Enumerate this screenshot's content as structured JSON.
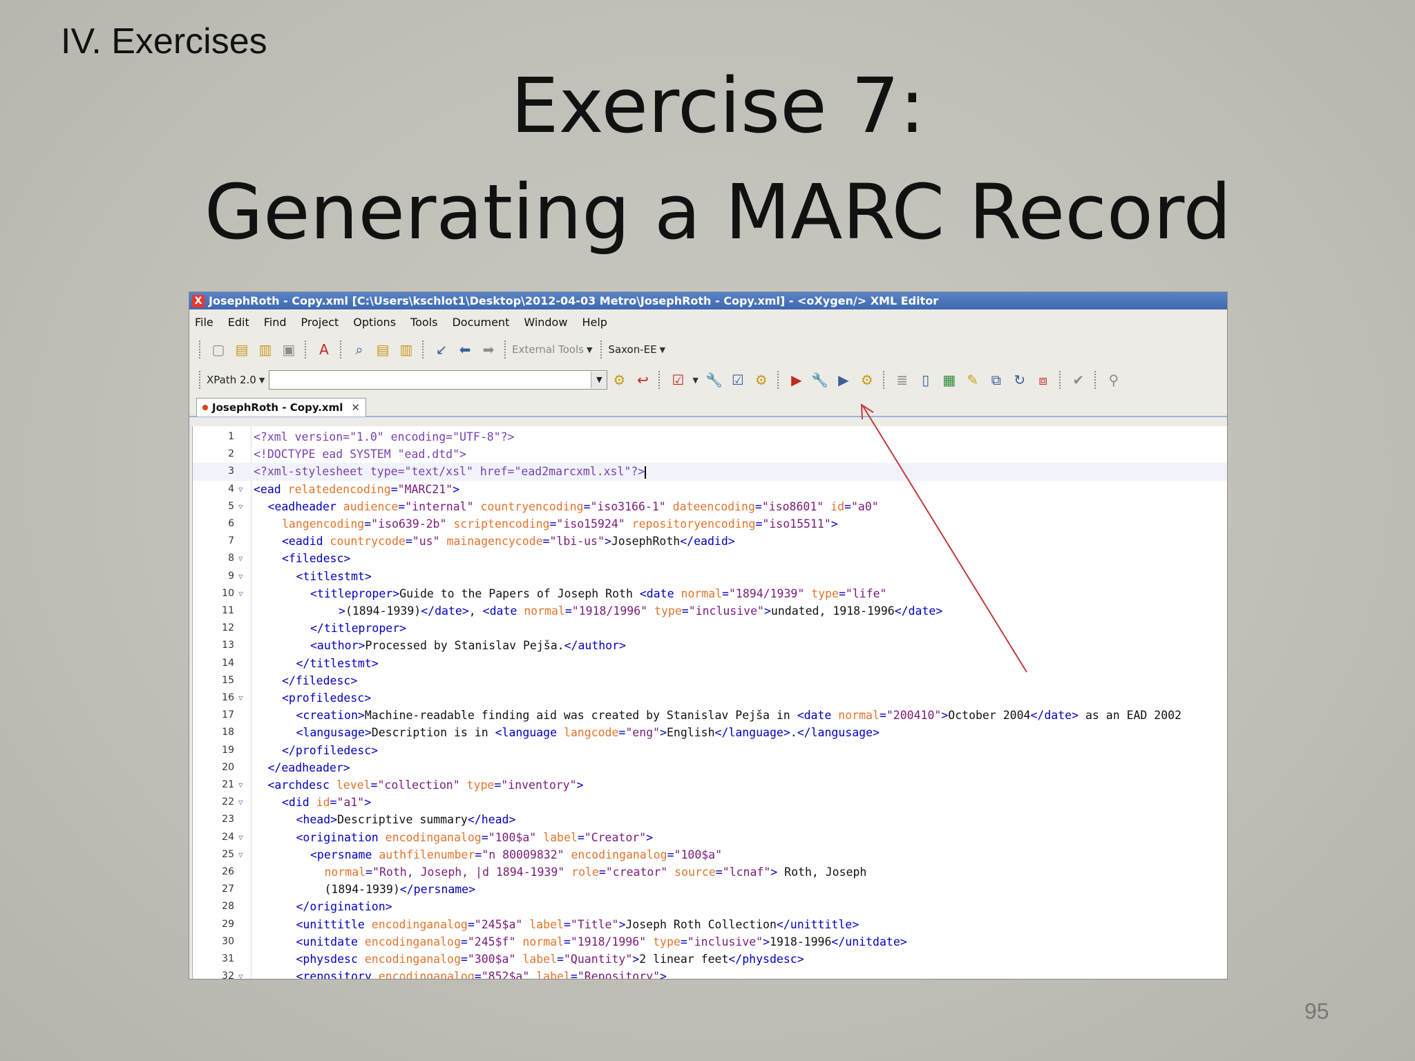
{
  "slide": {
    "section": "IV. Exercises",
    "title_line1": "Exercise 7:",
    "title_line2": "Generating a MARC Record",
    "page_number": "95"
  },
  "window": {
    "title": "JosephRoth - Copy.xml [C:\\Users\\kschlot1\\Desktop\\2012-04-03 Metro\\JosephRoth - Copy.xml] - <oXygen/> XML Editor",
    "app_icon": "oxygen-x-icon"
  },
  "menu": [
    "File",
    "Edit",
    "Find",
    "Project",
    "Options",
    "Tools",
    "Document",
    "Window",
    "Help"
  ],
  "toolbar": {
    "external_tools": "External Tools",
    "transformer": "Saxon-EE",
    "xpath_version": "XPath 2.0",
    "xpath_value": ""
  },
  "tab": {
    "label": "JosephRoth - Copy.xml"
  },
  "editor": {
    "lines": [
      {
        "n": "1",
        "fold": false,
        "indent": 0,
        "parts": [
          [
            "pi",
            "<?xml version=\"1.0\" encoding=\"UTF-8\"?>"
          ]
        ]
      },
      {
        "n": "2",
        "fold": false,
        "indent": 0,
        "parts": [
          [
            "pi",
            "<!DOCTYPE ead SYSTEM \"ead.dtd\">"
          ]
        ]
      },
      {
        "n": "3",
        "fold": false,
        "indent": 0,
        "current": true,
        "parts": [
          [
            "pi",
            "<?xml-stylesheet type=\"text/xsl\" href=\"ead2marcxml.xsl\"?>"
          ]
        ]
      },
      {
        "n": "4",
        "fold": true,
        "indent": 0,
        "parts": [
          [
            "tag",
            "<ead "
          ],
          [
            "attr",
            "relatedencoding"
          ],
          [
            "tag",
            "="
          ],
          [
            "val",
            "\"MARC21\""
          ],
          [
            "tag",
            ">"
          ]
        ]
      },
      {
        "n": "5",
        "fold": true,
        "indent": 1,
        "parts": [
          [
            "tag",
            "<eadheader "
          ],
          [
            "attr",
            "audience"
          ],
          [
            "tag",
            "="
          ],
          [
            "val",
            "\"internal\" "
          ],
          [
            "attr",
            "countryencoding"
          ],
          [
            "tag",
            "="
          ],
          [
            "val",
            "\"iso3166-1\" "
          ],
          [
            "attr",
            "dateencoding"
          ],
          [
            "tag",
            "="
          ],
          [
            "val",
            "\"iso8601\" "
          ],
          [
            "attr",
            "id"
          ],
          [
            "tag",
            "="
          ],
          [
            "val",
            "\"a0\""
          ]
        ]
      },
      {
        "n": "6",
        "fold": false,
        "indent": 2,
        "parts": [
          [
            "attr",
            "langencoding"
          ],
          [
            "tag",
            "="
          ],
          [
            "val",
            "\"iso639-2b\" "
          ],
          [
            "attr",
            "scriptencoding"
          ],
          [
            "tag",
            "="
          ],
          [
            "val",
            "\"iso15924\" "
          ],
          [
            "attr",
            "repositoryencoding"
          ],
          [
            "tag",
            "="
          ],
          [
            "val",
            "\"iso15511\""
          ],
          [
            "tag",
            ">"
          ]
        ]
      },
      {
        "n": "7",
        "fold": false,
        "indent": 2,
        "parts": [
          [
            "tag",
            "<eadid "
          ],
          [
            "attr",
            "countrycode"
          ],
          [
            "tag",
            "="
          ],
          [
            "val",
            "\"us\" "
          ],
          [
            "attr",
            "mainagencycode"
          ],
          [
            "tag",
            "="
          ],
          [
            "val",
            "\"lbi-us\""
          ],
          [
            "tag",
            ">"
          ],
          [
            "txt",
            "JosephRoth"
          ],
          [
            "tag",
            "</eadid>"
          ]
        ]
      },
      {
        "n": "8",
        "fold": true,
        "indent": 2,
        "parts": [
          [
            "tag",
            "<filedesc>"
          ]
        ]
      },
      {
        "n": "9",
        "fold": true,
        "indent": 3,
        "parts": [
          [
            "tag",
            "<titlestmt>"
          ]
        ]
      },
      {
        "n": "10",
        "fold": true,
        "indent": 4,
        "parts": [
          [
            "tag",
            "<titleproper>"
          ],
          [
            "txt",
            "Guide to the Papers of Joseph Roth "
          ],
          [
            "tag",
            "<date "
          ],
          [
            "attr",
            "normal"
          ],
          [
            "tag",
            "="
          ],
          [
            "val",
            "\"1894/1939\" "
          ],
          [
            "attr",
            "type"
          ],
          [
            "tag",
            "="
          ],
          [
            "val",
            "\"life\""
          ]
        ]
      },
      {
        "n": "11",
        "fold": false,
        "indent": 6,
        "parts": [
          [
            "tag",
            ">"
          ],
          [
            "txt",
            "(1894-1939)"
          ],
          [
            "tag",
            "</date>"
          ],
          [
            "txt",
            ", "
          ],
          [
            "tag",
            "<date "
          ],
          [
            "attr",
            "normal"
          ],
          [
            "tag",
            "="
          ],
          [
            "val",
            "\"1918/1996\" "
          ],
          [
            "attr",
            "type"
          ],
          [
            "tag",
            "="
          ],
          [
            "val",
            "\"inclusive\""
          ],
          [
            "tag",
            ">"
          ],
          [
            "txt",
            "undated, 1918-1996"
          ],
          [
            "tag",
            "</date>"
          ]
        ]
      },
      {
        "n": "12",
        "fold": false,
        "indent": 4,
        "parts": [
          [
            "tag",
            "</titleproper>"
          ]
        ]
      },
      {
        "n": "13",
        "fold": false,
        "indent": 4,
        "parts": [
          [
            "tag",
            "<author>"
          ],
          [
            "txt",
            "Processed by Stanislav Pejša."
          ],
          [
            "tag",
            "</author>"
          ]
        ]
      },
      {
        "n": "14",
        "fold": false,
        "indent": 3,
        "parts": [
          [
            "tag",
            "</titlestmt>"
          ]
        ]
      },
      {
        "n": "15",
        "fold": false,
        "indent": 2,
        "parts": [
          [
            "tag",
            "</filedesc>"
          ]
        ]
      },
      {
        "n": "16",
        "fold": true,
        "indent": 2,
        "parts": [
          [
            "tag",
            "<profiledesc>"
          ]
        ]
      },
      {
        "n": "17",
        "fold": false,
        "indent": 3,
        "parts": [
          [
            "tag",
            "<creation>"
          ],
          [
            "txt",
            "Machine-readable finding aid was created by Stanislav Pejša in "
          ],
          [
            "tag",
            "<date "
          ],
          [
            "attr",
            "normal"
          ],
          [
            "tag",
            "="
          ],
          [
            "val",
            "\"200410\""
          ],
          [
            "tag",
            ">"
          ],
          [
            "txt",
            "October 2004"
          ],
          [
            "tag",
            "</date>"
          ],
          [
            "txt",
            " as an EAD 2002"
          ]
        ]
      },
      {
        "n": "18",
        "fold": false,
        "indent": 3,
        "parts": [
          [
            "tag",
            "<langusage>"
          ],
          [
            "txt",
            "Description is in "
          ],
          [
            "tag",
            "<language "
          ],
          [
            "attr",
            "langcode"
          ],
          [
            "tag",
            "="
          ],
          [
            "val",
            "\"eng\""
          ],
          [
            "tag",
            ">"
          ],
          [
            "txt",
            "English"
          ],
          [
            "tag",
            "</language>"
          ],
          [
            "txt",
            "."
          ],
          [
            "tag",
            "</langusage>"
          ]
        ]
      },
      {
        "n": "19",
        "fold": false,
        "indent": 2,
        "parts": [
          [
            "tag",
            "</profiledesc>"
          ]
        ]
      },
      {
        "n": "20",
        "fold": false,
        "indent": 1,
        "parts": [
          [
            "tag",
            "</eadheader>"
          ]
        ]
      },
      {
        "n": "21",
        "fold": true,
        "indent": 1,
        "parts": [
          [
            "tag",
            "<archdesc "
          ],
          [
            "attr",
            "level"
          ],
          [
            "tag",
            "="
          ],
          [
            "val",
            "\"collection\" "
          ],
          [
            "attr",
            "type"
          ],
          [
            "tag",
            "="
          ],
          [
            "val",
            "\"inventory\""
          ],
          [
            "tag",
            ">"
          ]
        ]
      },
      {
        "n": "22",
        "fold": true,
        "indent": 2,
        "parts": [
          [
            "tag",
            "<did "
          ],
          [
            "attr",
            "id"
          ],
          [
            "tag",
            "="
          ],
          [
            "val",
            "\"a1\""
          ],
          [
            "tag",
            ">"
          ]
        ]
      },
      {
        "n": "23",
        "fold": false,
        "indent": 3,
        "parts": [
          [
            "tag",
            "<head>"
          ],
          [
            "txt",
            "Descriptive summary"
          ],
          [
            "tag",
            "</head>"
          ]
        ]
      },
      {
        "n": "24",
        "fold": true,
        "indent": 3,
        "parts": [
          [
            "tag",
            "<origination "
          ],
          [
            "attr",
            "encodinganalog"
          ],
          [
            "tag",
            "="
          ],
          [
            "val",
            "\"100$a\" "
          ],
          [
            "attr",
            "label"
          ],
          [
            "tag",
            "="
          ],
          [
            "val",
            "\"Creator\""
          ],
          [
            "tag",
            ">"
          ]
        ]
      },
      {
        "n": "25",
        "fold": true,
        "indent": 4,
        "parts": [
          [
            "tag",
            "<persname "
          ],
          [
            "attr",
            "authfilenumber"
          ],
          [
            "tag",
            "="
          ],
          [
            "val",
            "\"n 80009832\" "
          ],
          [
            "attr",
            "encodinganalog"
          ],
          [
            "tag",
            "="
          ],
          [
            "val",
            "\"100$a\""
          ]
        ]
      },
      {
        "n": "26",
        "fold": false,
        "indent": 5,
        "parts": [
          [
            "attr",
            "normal"
          ],
          [
            "tag",
            "="
          ],
          [
            "val",
            "\"Roth, Joseph, |d 1894-1939\" "
          ],
          [
            "attr",
            "role"
          ],
          [
            "tag",
            "="
          ],
          [
            "val",
            "\"creator\" "
          ],
          [
            "attr",
            "source"
          ],
          [
            "tag",
            "="
          ],
          [
            "val",
            "\"lcnaf\""
          ],
          [
            "tag",
            ">"
          ],
          [
            "txt",
            " Roth, Joseph"
          ]
        ]
      },
      {
        "n": "27",
        "fold": false,
        "indent": 5,
        "parts": [
          [
            "txt",
            "(1894-1939)"
          ],
          [
            "tag",
            "</persname>"
          ]
        ]
      },
      {
        "n": "28",
        "fold": false,
        "indent": 3,
        "parts": [
          [
            "tag",
            "</origination>"
          ]
        ]
      },
      {
        "n": "29",
        "fold": false,
        "indent": 3,
        "parts": [
          [
            "tag",
            "<unittitle "
          ],
          [
            "attr",
            "encodinganalog"
          ],
          [
            "tag",
            "="
          ],
          [
            "val",
            "\"245$a\" "
          ],
          [
            "attr",
            "label"
          ],
          [
            "tag",
            "="
          ],
          [
            "val",
            "\"Title\""
          ],
          [
            "tag",
            ">"
          ],
          [
            "txt",
            "Joseph Roth Collection"
          ],
          [
            "tag",
            "</unittitle>"
          ]
        ]
      },
      {
        "n": "30",
        "fold": false,
        "indent": 3,
        "parts": [
          [
            "tag",
            "<unitdate "
          ],
          [
            "attr",
            "encodinganalog"
          ],
          [
            "tag",
            "="
          ],
          [
            "val",
            "\"245$f\" "
          ],
          [
            "attr",
            "normal"
          ],
          [
            "tag",
            "="
          ],
          [
            "val",
            "\"1918/1996\" "
          ],
          [
            "attr",
            "type"
          ],
          [
            "tag",
            "="
          ],
          [
            "val",
            "\"inclusive\""
          ],
          [
            "tag",
            ">"
          ],
          [
            "txt",
            "1918-1996"
          ],
          [
            "tag",
            "</unitdate>"
          ]
        ]
      },
      {
        "n": "31",
        "fold": false,
        "indent": 3,
        "parts": [
          [
            "tag",
            "<physdesc "
          ],
          [
            "attr",
            "encodinganalog"
          ],
          [
            "tag",
            "="
          ],
          [
            "val",
            "\"300$a\" "
          ],
          [
            "attr",
            "label"
          ],
          [
            "tag",
            "="
          ],
          [
            "val",
            "\"Quantity\""
          ],
          [
            "tag",
            ">"
          ],
          [
            "txt",
            "2 linear feet"
          ],
          [
            "tag",
            "</physdesc>"
          ]
        ]
      },
      {
        "n": "32",
        "fold": true,
        "indent": 3,
        "parts": [
          [
            "tag",
            "<repository "
          ],
          [
            "attr",
            "encodinganalog"
          ],
          [
            "tag",
            "="
          ],
          [
            "val",
            "\"852$a\" "
          ],
          [
            "attr",
            "label"
          ],
          [
            "tag",
            "="
          ],
          [
            "val",
            "\"Repository\""
          ],
          [
            "tag",
            ">"
          ]
        ]
      }
    ]
  }
}
